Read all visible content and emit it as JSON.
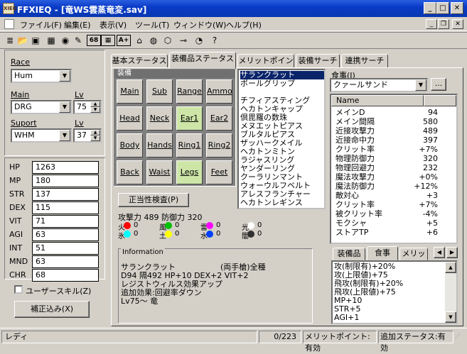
{
  "window": {
    "title": "FFXIEQ - [竜WS雲蒸竜変.sav]",
    "icon_text": "XIEQ"
  },
  "menu": [
    "ファイル(F)",
    "編集(E)",
    "表示(V)",
    "ツール(T)",
    "ウィンドウ(W)",
    "ヘルプ(H)"
  ],
  "toolbar": [
    "new-icon",
    "open-icon",
    "save-icon",
    "book-icon",
    "eraser-icon",
    "edit-icon",
    "num68-icon",
    "numbox-icon",
    "a-plus-icon",
    "home-icon",
    "palette-icon",
    "hexagon-icon",
    "key-icon",
    "food-icon",
    "help-icon"
  ],
  "toolbar_glyphs": [
    "≣",
    "📂",
    "▣",
    "▦",
    "◉",
    "✎",
    "68",
    "▦",
    "A+",
    "⌂",
    "◍",
    "⬡",
    "⊸",
    "◔",
    "?"
  ],
  "left": {
    "race_label": "Race",
    "race_value": "Hum",
    "main_label": "Main",
    "main_value": "DRG",
    "lv_label": "Lv",
    "main_lv": "75",
    "sub_label": "Suport",
    "sub_value": "WHM",
    "sub_lv_label": "Lv",
    "sub_lv": "37",
    "stats": [
      {
        "k": "HP",
        "v": "1263"
      },
      {
        "k": "MP",
        "v": "180"
      },
      {
        "k": "STR",
        "v": "137"
      },
      {
        "k": "DEX",
        "v": "115"
      },
      {
        "k": "VIT",
        "v": "71"
      },
      {
        "k": "AGI",
        "v": "63"
      },
      {
        "k": "INT",
        "v": "51"
      },
      {
        "k": "MND",
        "v": "63"
      },
      {
        "k": "CHR",
        "v": "68"
      }
    ],
    "user_skill": "ユーザースキル(Z)",
    "adjust": "補正込み(X)"
  },
  "tabs": [
    "基本ステータス",
    "装備品ステータス",
    "メリットポイント",
    "装備サーチ",
    "連携サーチ"
  ],
  "equip": {
    "header": "装備",
    "slots": [
      "Main",
      "Sub",
      "Range",
      "Ammo",
      "Head",
      "Neck",
      "Ear1",
      "Ear2",
      "Body",
      "Hands",
      "Ring1",
      "Ring2",
      "Back",
      "Waist",
      "Legs",
      "Feet"
    ],
    "check_button": "正当性検査(P)",
    "atk_line": "攻撃力 489 防御力 320",
    "elements": [
      {
        "k": "火",
        "v": "0",
        "c": "#ff0000"
      },
      {
        "k": "風",
        "v": "0",
        "c": "#00c000"
      },
      {
        "k": "雷",
        "v": "0",
        "c": "#ff00ff"
      },
      {
        "k": "光",
        "v": "0",
        "c": "#ffffff"
      },
      {
        "k": "氷",
        "v": "0",
        "c": "#00ffff"
      },
      {
        "k": "土",
        "v": "0",
        "c": "#ffff00"
      },
      {
        "k": "水",
        "v": "0",
        "c": "#0040ff"
      },
      {
        "k": "闇",
        "v": "0",
        "c": "#303030"
      }
    ],
    "info_header": "Information",
    "info": [
      "サランクラット",
      "D94 隔492 HP+10 DEX+2 VIT+2",
      "レジストウィルス効果アップ",
      "追加効果:回避率ダウン",
      "Lv75～ 竜"
    ],
    "info_tag": "(両手槍)全種"
  },
  "itemlist": [
    "サランクラット",
    "ボールグリップ",
    "",
    "チフィアスティング",
    "ヘカトンキャップ",
    "倶毘羅の数珠",
    "メヌエットピアス",
    "ブルタルピアス",
    "ザッハークメイル",
    "ヘカトンミトン",
    "ラジャスリング",
    "ヤンダーリング",
    "クーラリンマント",
    "ウォーウルフベルト",
    "アレスフランチャー",
    "ヘカトンレギンス"
  ],
  "food": {
    "label": "食事(J)",
    "value": "クァールサンド",
    "btn": "..."
  },
  "stat_grid": {
    "header": "Name",
    "rows": [
      {
        "n": "メインD",
        "v": "94"
      },
      {
        "n": "メイン間隔",
        "v": "580"
      },
      {
        "n": "近接攻撃力",
        "v": "489"
      },
      {
        "n": "近接命中力",
        "v": "397"
      },
      {
        "n": "クリット率",
        "v": "+7%"
      },
      {
        "n": "物理防御力",
        "v": "320"
      },
      {
        "n": "物理回避力",
        "v": "232"
      },
      {
        "n": "魔法攻撃力",
        "v": "+0%"
      },
      {
        "n": "魔法防御力",
        "v": "+12%"
      },
      {
        "n": "敵対心",
        "v": "+3"
      },
      {
        "n": "クリット率",
        "v": "+7%"
      },
      {
        "n": "被クリット率",
        "v": "-4%"
      },
      {
        "n": "モクシャ",
        "v": "+5"
      },
      {
        "n": "ストアTP",
        "v": "+6"
      }
    ]
  },
  "small_tabs": [
    "装備品",
    "食事",
    "メリッ"
  ],
  "food_effects": [
    "攻(制限有)+20%",
    "攻(上限値)+75",
    "飛攻(制限有)+20%",
    "飛攻(上限値)+75",
    "MP+10",
    "STR+5",
    "AGI+1"
  ],
  "status": {
    "left": "レディ",
    "count": "0/223",
    "merit": "メリットポイント:有効",
    "extra": "追加ステータス:有効"
  }
}
